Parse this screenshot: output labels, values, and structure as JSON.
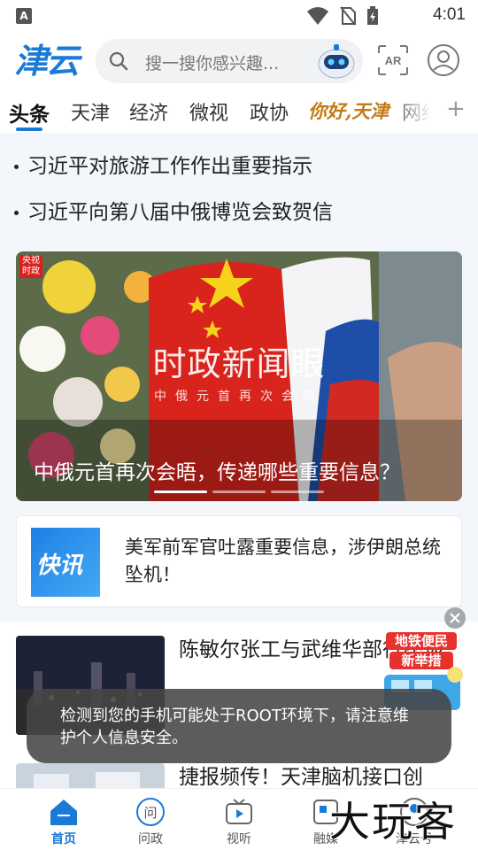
{
  "status_bar": {
    "time": "4:01",
    "left_badge": "A",
    "icons": [
      "wifi-icon",
      "no-sim-icon",
      "battery-charging-icon"
    ]
  },
  "header": {
    "logo_text": "津云",
    "search_placeholder": "搜一搜你感兴趣...",
    "ar_label": "AR"
  },
  "tabs": [
    {
      "label": "头条",
      "active": true
    },
    {
      "label": "天津"
    },
    {
      "label": "经济"
    },
    {
      "label": "微视"
    },
    {
      "label": "政协"
    },
    {
      "label": "你好,天津"
    },
    {
      "label": "网络"
    }
  ],
  "top_news": [
    "习近平对旅游工作作出重要指示",
    "习近平向第八届中俄博览会致贺信"
  ],
  "banner": {
    "corner_tag": "央视\n时政",
    "overlay_title": "时政新闻眼",
    "overlay_subtitle": "中俄元首再次会晤",
    "caption": "中俄元首再次会晤，传递哪些重要信息？",
    "slide_count": 3,
    "active_slide": 1
  },
  "flash_card": {
    "logo_text": "快讯",
    "text": "美军前军官吐露重要信息，涉伊朗总统坠机！"
  },
  "news": [
    {
      "title": "陈敏尔张工与武维华部行座谈"
    },
    {
      "title": "捷报频传！天津脑机接口创"
    }
  ],
  "ad_float": {
    "line1": "地铁便民",
    "line2": "新举措"
  },
  "toast": "检测到您的手机可能处于ROOT环境下，请注意维护个人信息安全。",
  "bottom_nav": [
    {
      "label": "首页",
      "icon": "home-icon",
      "active": true
    },
    {
      "label": "问政",
      "icon": "ask-icon"
    },
    {
      "label": "视听",
      "icon": "tv-icon"
    },
    {
      "label": "融媒",
      "icon": "media-icon"
    },
    {
      "label": "津云号",
      "icon": "account-icon"
    }
  ],
  "watermark": "大玩客",
  "colors": {
    "accent": "#1a7ad6",
    "toast_bg": "#464646"
  }
}
